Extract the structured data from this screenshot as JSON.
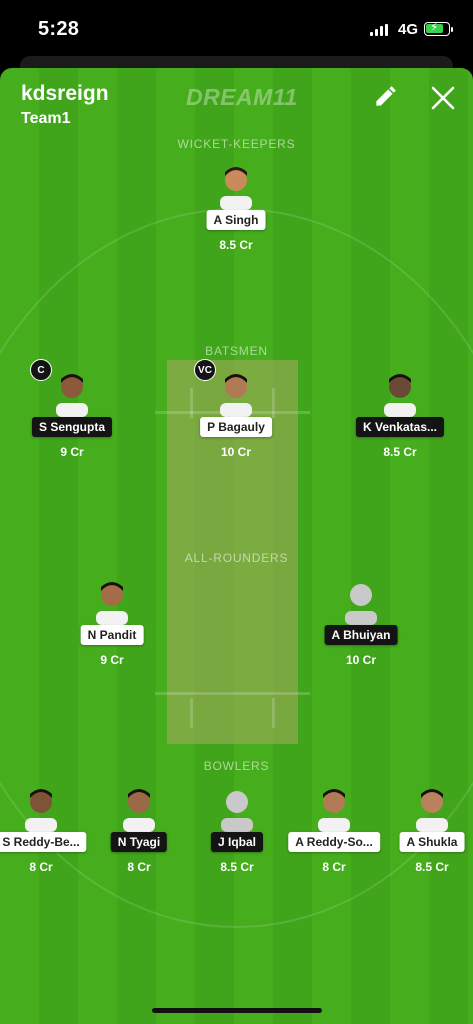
{
  "status_bar": {
    "time": "5:28",
    "network": "4G"
  },
  "header": {
    "team_owner": "kdsreign",
    "team_name": "Team1",
    "logo_text": "DREAM11"
  },
  "sections": {
    "wicket_keepers": "WICKET-KEEPERS",
    "batsmen": "BATSMEN",
    "all_rounders": "ALL-ROUNDERS",
    "bowlers": "BOWLERS"
  },
  "players": {
    "wk1": {
      "name": "A Singh",
      "price": "8.5 Cr"
    },
    "bat1": {
      "name": "S Sengupta",
      "price": "9 Cr",
      "badge": "C"
    },
    "bat2": {
      "name": "P Bagauly",
      "price": "10 Cr",
      "badge": "VC"
    },
    "bat3": {
      "name": "K Venkatas...",
      "price": "8.5 Cr"
    },
    "ar1": {
      "name": "N Pandit",
      "price": "9 Cr"
    },
    "ar2": {
      "name": "A Bhuiyan",
      "price": "10 Cr"
    },
    "bowl1": {
      "name": "S Reddy-Be...",
      "price": "8 Cr"
    },
    "bowl2": {
      "name": "N Tyagi",
      "price": "8 Cr"
    },
    "bowl3": {
      "name": "J Iqbal",
      "price": "8.5 Cr"
    },
    "bowl4": {
      "name": "A Reddy-So...",
      "price": "8 Cr"
    },
    "bowl5": {
      "name": "A Shukla",
      "price": "8.5 Cr"
    }
  },
  "colors": {
    "field_green": "#46ad1d",
    "pitch": "#beaa6e",
    "name_dark": "#141414",
    "name_light": "#ffffff"
  }
}
